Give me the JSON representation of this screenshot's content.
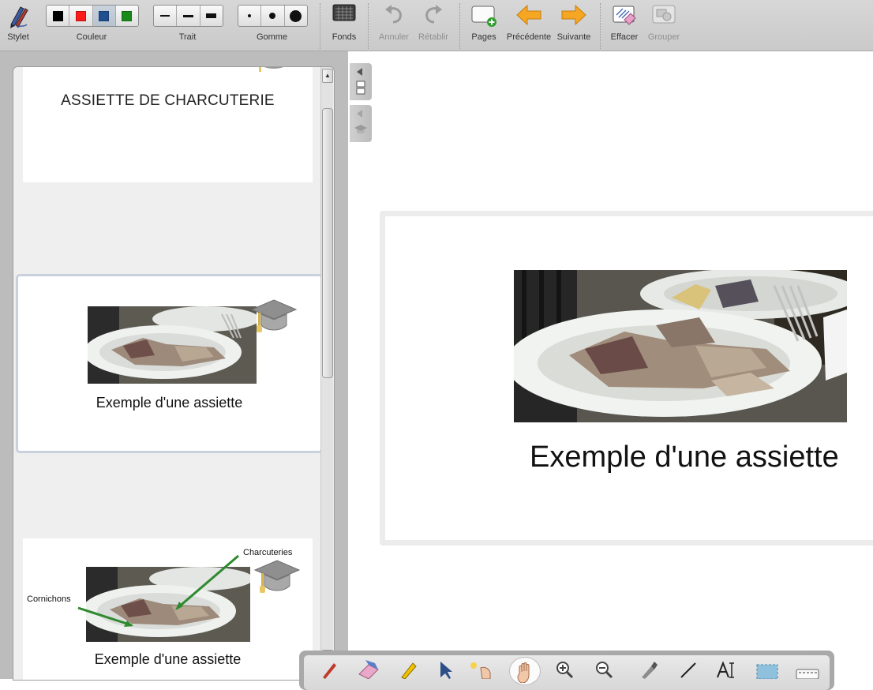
{
  "toolbar": {
    "stylet_label": "Stylet",
    "couleur_label": "Couleur",
    "trait_label": "Trait",
    "gomme_label": "Gomme",
    "fonds_label": "Fonds",
    "annuler_label": "Annuler",
    "retablir_label": "Rétablir",
    "pages_label": "Pages",
    "precedente_label": "Précédente",
    "suivante_label": "Suivante",
    "effacer_label": "Effacer",
    "grouper_label": "Grouper",
    "colors": [
      "#000000",
      "#ff1a1a",
      "#1f4f8f",
      "#1a8a1a"
    ],
    "accent_arrow": "#f5a623"
  },
  "thumbnails": {
    "slide1_title": "ASSIETTE DE CHARCUTERIE",
    "slide2_caption": "Exemple d'une assiette",
    "slide3_caption": "Exemple d'une assiette",
    "slide3_annotation_left": "Cornichons",
    "slide3_annotation_right": "Charcuteries"
  },
  "main_slide": {
    "caption": "Exemple d'une assiette"
  },
  "bottom_tools": [
    "pen-icon",
    "eraser-icon",
    "highlighter-icon",
    "pointer-icon",
    "laser-pointer-icon",
    "hand-icon",
    "zoom-in-icon",
    "zoom-out-icon",
    "capture-icon",
    "line-icon",
    "text-icon",
    "selection-icon",
    "keyboard-icon"
  ]
}
